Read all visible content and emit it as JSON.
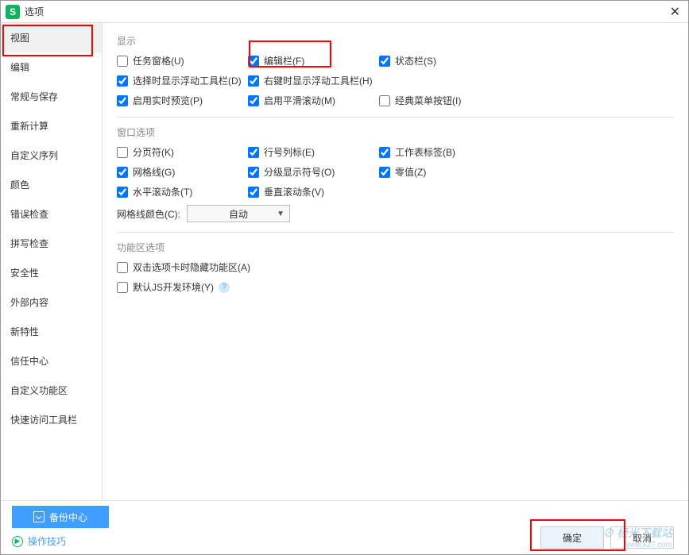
{
  "title": "选项",
  "close": "✕",
  "sidebar": {
    "items": [
      {
        "label": "视图",
        "active": true
      },
      {
        "label": "编辑"
      },
      {
        "label": "常规与保存"
      },
      {
        "label": "重新计算"
      },
      {
        "label": "自定义序列"
      },
      {
        "label": "颜色"
      },
      {
        "label": "错误检查"
      },
      {
        "label": "拼写检查"
      },
      {
        "label": "安全性"
      },
      {
        "label": "外部内容"
      },
      {
        "label": "新特性"
      },
      {
        "label": "信任中心"
      },
      {
        "label": "自定义功能区"
      },
      {
        "label": "快速访问工具栏"
      }
    ]
  },
  "sections": {
    "display": {
      "title": "显示",
      "items": {
        "taskpane": {
          "label": "任务窗格(U)",
          "checked": false
        },
        "editbar": {
          "label": "编辑栏(F)",
          "checked": true
        },
        "statusbar": {
          "label": "状态栏(S)",
          "checked": true
        },
        "floatselect": {
          "label": "选择时显示浮动工具栏(D)",
          "checked": true
        },
        "floatright": {
          "label": "右键时显示浮动工具栏(H)",
          "checked": true
        },
        "preview": {
          "label": "启用实时预览(P)",
          "checked": true
        },
        "smoothscroll": {
          "label": "启用平滑滚动(M)",
          "checked": true
        },
        "classicmenu": {
          "label": "经典菜单按钮(I)",
          "checked": false
        }
      }
    },
    "window": {
      "title": "窗口选项",
      "items": {
        "pagebreak": {
          "label": "分页符(K)",
          "checked": false
        },
        "rowcolhead": {
          "label": "行号列标(E)",
          "checked": true
        },
        "sheettab": {
          "label": "工作表标签(B)",
          "checked": true
        },
        "gridlines": {
          "label": "网格线(G)",
          "checked": true
        },
        "outline": {
          "label": "分级显示符号(O)",
          "checked": true
        },
        "zero": {
          "label": "零值(Z)",
          "checked": true
        },
        "hscroll": {
          "label": "水平滚动条(T)",
          "checked": true
        },
        "vscroll": {
          "label": "垂直滚动条(V)",
          "checked": true
        }
      },
      "gridcolor_label": "网格线颜色(C):",
      "gridcolor_value": "自动"
    },
    "ribbon": {
      "title": "功能区选项",
      "items": {
        "dblclick": {
          "label": "双击选项卡时隐藏功能区(A)",
          "checked": false
        },
        "jsdev": {
          "label": "默认JS开发环境(Y)",
          "checked": false
        }
      }
    }
  },
  "footer": {
    "backup": "备份中心",
    "tips": "操作技巧",
    "ok": "确定",
    "cancel": "取消"
  },
  "watermark": {
    "line1": "⊘ 极光下载站",
    "line2": "www.xz7.com"
  }
}
